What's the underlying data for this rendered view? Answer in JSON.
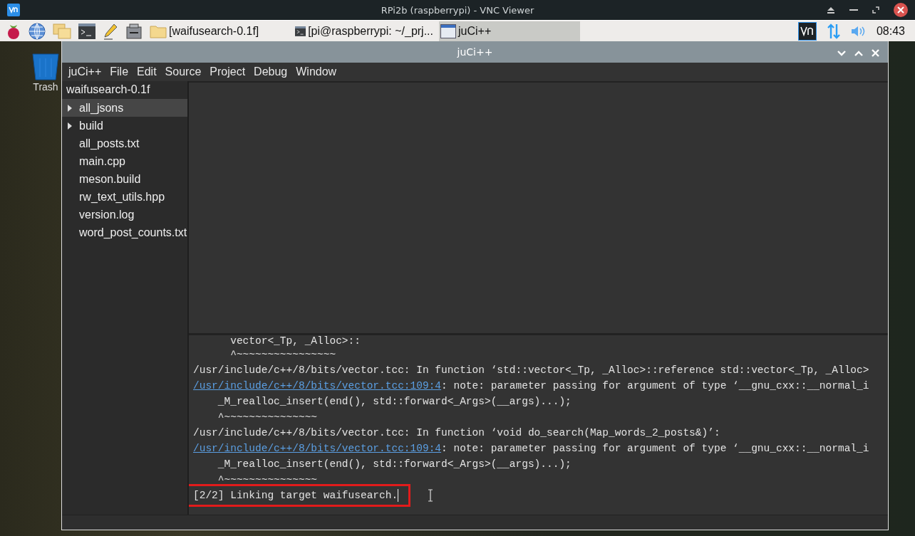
{
  "viewer": {
    "title": "RPi2b (raspberrypi) - VNC Viewer"
  },
  "taskbar": {
    "tasks": [
      {
        "kind": "folder",
        "label": "[waifusearch-0.1f]",
        "selected": false
      },
      {
        "kind": "terminal",
        "label": "[pi@raspberrypi: ~/_prj...",
        "selected": false
      },
      {
        "kind": "window",
        "label": "juCi++",
        "selected": true
      }
    ],
    "clock": "08:43"
  },
  "desktop": {
    "icons": [
      {
        "label": "Trash"
      }
    ]
  },
  "window": {
    "title": "juCi++",
    "menu": [
      "juCi++",
      "File",
      "Edit",
      "Source",
      "Project",
      "Debug",
      "Window"
    ],
    "project": "waifusearch-0.1f",
    "files": [
      {
        "name": "all_jsons",
        "kind": "folder",
        "selected": true
      },
      {
        "name": "build",
        "kind": "folder",
        "selected": false
      },
      {
        "name": "all_posts.txt",
        "kind": "file",
        "selected": false
      },
      {
        "name": "main.cpp",
        "kind": "file",
        "selected": false
      },
      {
        "name": "meson.build",
        "kind": "file",
        "selected": false
      },
      {
        "name": "rw_text_utils.hpp",
        "kind": "file",
        "selected": false
      },
      {
        "name": "version.log",
        "kind": "file",
        "selected": false
      },
      {
        "name": "word_post_counts.txt",
        "kind": "file",
        "selected": false
      }
    ],
    "terminal": [
      {
        "text": "      vector<_Tp, _Alloc>::"
      },
      {
        "text": "      ^~~~~~~~~~~~~~~~~"
      },
      {
        "text": "/usr/include/c++/8/bits/vector.tcc: In function ‘std::vector<_Tp, _Alloc>::reference std::vector<_Tp, _Alloc>"
      },
      {
        "link": "/usr/include/c++/8/bits/vector.tcc:109:4",
        "text": ": note: parameter passing for argument of type ‘__gnu_cxx::__normal_i"
      },
      {
        "text": "    _M_realloc_insert(end(), std::forward<_Args>(__args)...);"
      },
      {
        "text": "    ^~~~~~~~~~~~~~~~"
      },
      {
        "text": "/usr/include/c++/8/bits/vector.tcc: In function ‘void do_search(Map_words_2_posts&)’:"
      },
      {
        "link": "/usr/include/c++/8/bits/vector.tcc:109:4",
        "text": ": note: parameter passing for argument of type ‘__gnu_cxx::__normal_i"
      },
      {
        "text": "    _M_realloc_insert(end(), std::forward<_Args>(__args)...);"
      },
      {
        "text": "    ^~~~~~~~~~~~~~~~"
      },
      {
        "text": "[2/2] Linking target waifusearch.",
        "highlighted": true
      }
    ]
  }
}
